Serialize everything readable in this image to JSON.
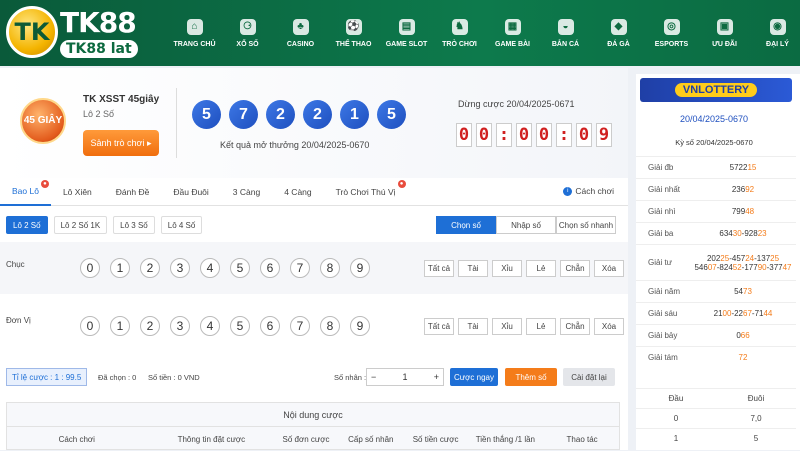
{
  "brand": {
    "title": "TK88",
    "domain": "TK88 lat",
    "badge": "TK"
  },
  "nav": [
    {
      "icon": "home-icon",
      "glyph": "⌂",
      "label": "TRANG CHỦ"
    },
    {
      "icon": "lottery-ball-icon",
      "glyph": "⚆",
      "label": "XỔ SỐ"
    },
    {
      "icon": "casino-icon",
      "glyph": "♣",
      "label": "CASINO"
    },
    {
      "icon": "soccer-icon",
      "glyph": "⚽",
      "label": "THỂ THAO"
    },
    {
      "icon": "slot-machine-icon",
      "glyph": "▤",
      "label": "GAME SLOT"
    },
    {
      "icon": "chess-icon",
      "glyph": "♞",
      "label": "TRÒ CHƠI"
    },
    {
      "icon": "cards-icon",
      "glyph": "▦",
      "label": "GAME BÀI"
    },
    {
      "icon": "fish-icon",
      "glyph": "◒",
      "label": "BẮN CÁ"
    },
    {
      "icon": "rooster-icon",
      "glyph": "◆",
      "label": "ĐÁ GÀ"
    },
    {
      "icon": "gamepad-icon",
      "glyph": "◎",
      "label": "ESPORTS"
    },
    {
      "icon": "gift-icon",
      "glyph": "▣",
      "label": "ƯU ĐÃI"
    },
    {
      "icon": "agent-icon",
      "glyph": "◉",
      "label": "ĐẠI LÝ"
    }
  ],
  "game": {
    "badge": "45 GIÂY",
    "name": "TK XSST 45giây",
    "sub": "Lô 2 Số",
    "change_label": "Sảnh trò chơi ▸"
  },
  "results": {
    "balls": [
      "5",
      "7",
      "2",
      "2",
      "1",
      "5"
    ],
    "label": "Kết quả mở thưởng 20/04/2025-0670"
  },
  "countdown": {
    "label": "Dừng cược 20/04/2025-0671",
    "digits": [
      "0",
      "0",
      ":",
      "0",
      "0",
      ":",
      "0",
      "9"
    ]
  },
  "tabs": [
    {
      "label": "Bao Lô",
      "active": true,
      "badge": true
    },
    {
      "label": "Lô Xiên"
    },
    {
      "label": "Đánh Đề"
    },
    {
      "label": "Đầu Đuôi"
    },
    {
      "label": "3 Càng"
    },
    {
      "label": "4 Càng"
    },
    {
      "label": "Trò Chơi Thú Vị",
      "badge": true
    }
  ],
  "help_label": "Cách chơi",
  "subtabs": [
    {
      "label": "Lô 2 Số",
      "active": true
    },
    {
      "label": "Lô 2 Số 1K"
    },
    {
      "label": "Lô 3 Số"
    },
    {
      "label": "Lô 4 Số"
    }
  ],
  "modes": [
    {
      "label": "Chọn số",
      "active": true
    },
    {
      "label": "Nhập số"
    },
    {
      "label": "Chọn số nhanh"
    }
  ],
  "rows": [
    {
      "label": "Chục"
    },
    {
      "label": "Đơn Vị"
    }
  ],
  "digits": [
    "0",
    "1",
    "2",
    "3",
    "4",
    "5",
    "6",
    "7",
    "8",
    "9"
  ],
  "quick": [
    "Tất cả",
    "Tài",
    "Xỉu",
    "Lẻ",
    "Chẵn",
    "Xóa"
  ],
  "footer": {
    "odds": "Tỉ lệ cược : 1 : 99.5",
    "chosen": "Đã chọn : 0",
    "money": "Số tiền : 0 VND",
    "mult_label": "Số nhân :",
    "mult_value": "1",
    "bet_label": "Cược ngay",
    "add_label": "Thêm số",
    "reset_label": "Cài đặt lại"
  },
  "bet_table": {
    "title": "Nội dung cược",
    "cols": [
      "Cách chơi",
      "Thông tin đặt cược",
      "Số đơn cược",
      "Cấp số nhân",
      "Số tiền cược",
      "Tiền thắng /1 lần",
      "Thao tác"
    ]
  },
  "side": {
    "logo": "VNLOTTERY",
    "date": "20/04/2025-0670",
    "sub": "Kỳ số 20/04/2025-0670",
    "prizes": [
      {
        "name": "Giải đb",
        "lines": [
          [
            [
              "5722",
              ""
            ],
            [
              "15",
              "hl"
            ]
          ]
        ]
      },
      {
        "name": "Giải nhất",
        "lines": [
          [
            [
              "236",
              ""
            ],
            [
              "92",
              "hl"
            ]
          ]
        ]
      },
      {
        "name": "Giải nhì",
        "lines": [
          [
            [
              "799",
              ""
            ],
            [
              "48",
              "hl"
            ]
          ]
        ]
      },
      {
        "name": "Giải ba",
        "lines": [
          [
            [
              "634",
              ""
            ],
            [
              "30",
              "hl"
            ],
            [
              "-928",
              ""
            ],
            [
              "23",
              "hl"
            ]
          ]
        ]
      },
      {
        "name": "Giải tư",
        "lines": [
          [
            [
              "202",
              ""
            ],
            [
              "25",
              "hl"
            ],
            [
              "-457",
              ""
            ],
            [
              "24",
              "hl"
            ],
            [
              "-137",
              ""
            ],
            [
              "25",
              "hl"
            ]
          ],
          [
            [
              "546",
              ""
            ],
            [
              "07",
              "hl"
            ],
            [
              "-824",
              ""
            ],
            [
              "52",
              "hl"
            ],
            [
              "-177",
              ""
            ],
            [
              "90",
              "hl"
            ],
            [
              "-377",
              ""
            ],
            [
              "47",
              "hl"
            ]
          ]
        ]
      },
      {
        "name": "Giải năm",
        "lines": [
          [
            [
              "54",
              ""
            ],
            [
              "73",
              "hl"
            ]
          ]
        ]
      },
      {
        "name": "Giải sáu",
        "lines": [
          [
            [
              "21",
              ""
            ],
            [
              "00",
              "hl"
            ],
            [
              "-22",
              ""
            ],
            [
              "67",
              "hl"
            ],
            [
              "-71",
              ""
            ],
            [
              "44",
              "hl"
            ]
          ]
        ]
      },
      {
        "name": "Giải bảy",
        "lines": [
          [
            [
              "0",
              ""
            ],
            [
              "66",
              "hl"
            ]
          ]
        ]
      },
      {
        "name": "Giải tám",
        "lines": [
          [
            [
              "72",
              "hl"
            ]
          ]
        ]
      }
    ],
    "dd_head": [
      "Đầu",
      "Đuôi"
    ],
    "dd_rows": [
      [
        "0",
        "7,0"
      ],
      [
        "1",
        "5"
      ]
    ]
  }
}
